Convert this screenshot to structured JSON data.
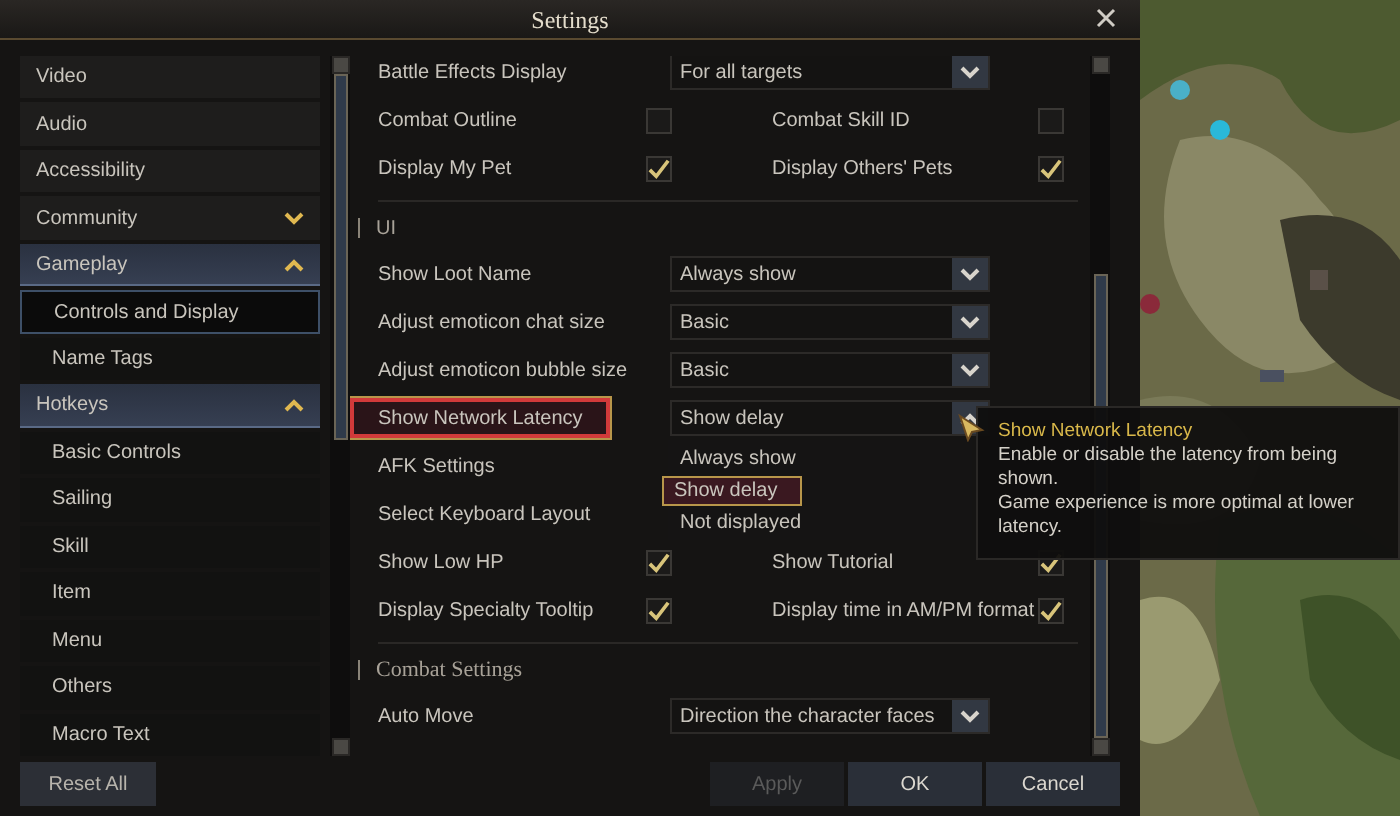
{
  "window": {
    "title": "Settings"
  },
  "sidebar": {
    "items": [
      {
        "label": "Video",
        "selected": false
      },
      {
        "label": "Audio",
        "selected": false
      },
      {
        "label": "Accessibility",
        "selected": false
      },
      {
        "label": "Community",
        "selected": false,
        "expanded": false
      },
      {
        "label": "Gameplay",
        "selected": false,
        "expanded": true,
        "children": [
          {
            "label": "Controls and Display",
            "selected": true
          },
          {
            "label": "Name Tags",
            "selected": false
          }
        ]
      },
      {
        "label": "Hotkeys",
        "selected": false,
        "expanded": true,
        "children": [
          {
            "label": "Basic Controls",
            "selected": false
          },
          {
            "label": "Sailing",
            "selected": false
          },
          {
            "label": "Skill",
            "selected": false
          },
          {
            "label": "Item",
            "selected": false
          },
          {
            "label": "Menu",
            "selected": false
          },
          {
            "label": "Others",
            "selected": false
          },
          {
            "label": "Macro Text",
            "selected": false
          }
        ]
      }
    ]
  },
  "sections": [
    {
      "rows": [
        {
          "kind": "dropdown",
          "label": "Battle Effects Display",
          "value": "For all targets",
          "open": false,
          "highlighted": false
        },
        {
          "kind": "checkboxes",
          "items": [
            {
              "label": "Combat Outline",
              "checked": false
            },
            {
              "label": "Combat Skill ID",
              "checked": false
            }
          ]
        },
        {
          "kind": "checkboxes",
          "items": [
            {
              "label": "Display My Pet",
              "checked": true
            },
            {
              "label": "Display Others' Pets",
              "checked": true
            }
          ]
        }
      ]
    },
    {
      "title": "UI",
      "rows": [
        {
          "kind": "dropdown",
          "label": "Show Loot Name",
          "value": "Always show",
          "open": false,
          "highlighted": false
        },
        {
          "kind": "dropdown",
          "label": "Adjust emoticon chat size",
          "value": "Basic",
          "open": false,
          "highlighted": false
        },
        {
          "kind": "dropdown",
          "label": "Adjust emoticon bubble size",
          "value": "Basic",
          "open": false,
          "highlighted": false
        },
        {
          "kind": "dropdown",
          "label": "Show Network Latency",
          "value": "Show delay",
          "open": true,
          "highlighted": true,
          "options": [
            {
              "label": "Always show",
              "selected": false
            },
            {
              "label": "Show delay",
              "selected": true
            },
            {
              "label": "Not displayed",
              "selected": false
            }
          ]
        },
        {
          "kind": "covered",
          "label": "AFK Settings"
        },
        {
          "kind": "covered",
          "label": "Select Keyboard Layout"
        },
        {
          "kind": "checkboxes",
          "items": [
            {
              "label": "Show Low HP",
              "checked": true
            },
            {
              "label": "Show Tutorial",
              "checked": true
            }
          ]
        },
        {
          "kind": "checkboxes",
          "items": [
            {
              "label": "Display Specialty Tooltip",
              "checked": true
            },
            {
              "label": "Display time in AM/PM format",
              "checked": true
            }
          ]
        }
      ]
    },
    {
      "title": "Combat Settings",
      "rows": [
        {
          "kind": "dropdown",
          "label": "Auto Move",
          "value": "Direction the character faces",
          "open": false,
          "highlighted": false
        }
      ]
    }
  ],
  "tooltip": {
    "title": "Show Network Latency",
    "lines": [
      "Enable or disable the latency from being shown.",
      "Game experience is more optimal at lower latency."
    ]
  },
  "footer": {
    "reset": {
      "label": "Reset All"
    },
    "buttons": [
      {
        "label": "Apply",
        "disabled": true
      },
      {
        "label": "OK",
        "disabled": false
      },
      {
        "label": "Cancel",
        "disabled": false
      }
    ]
  }
}
